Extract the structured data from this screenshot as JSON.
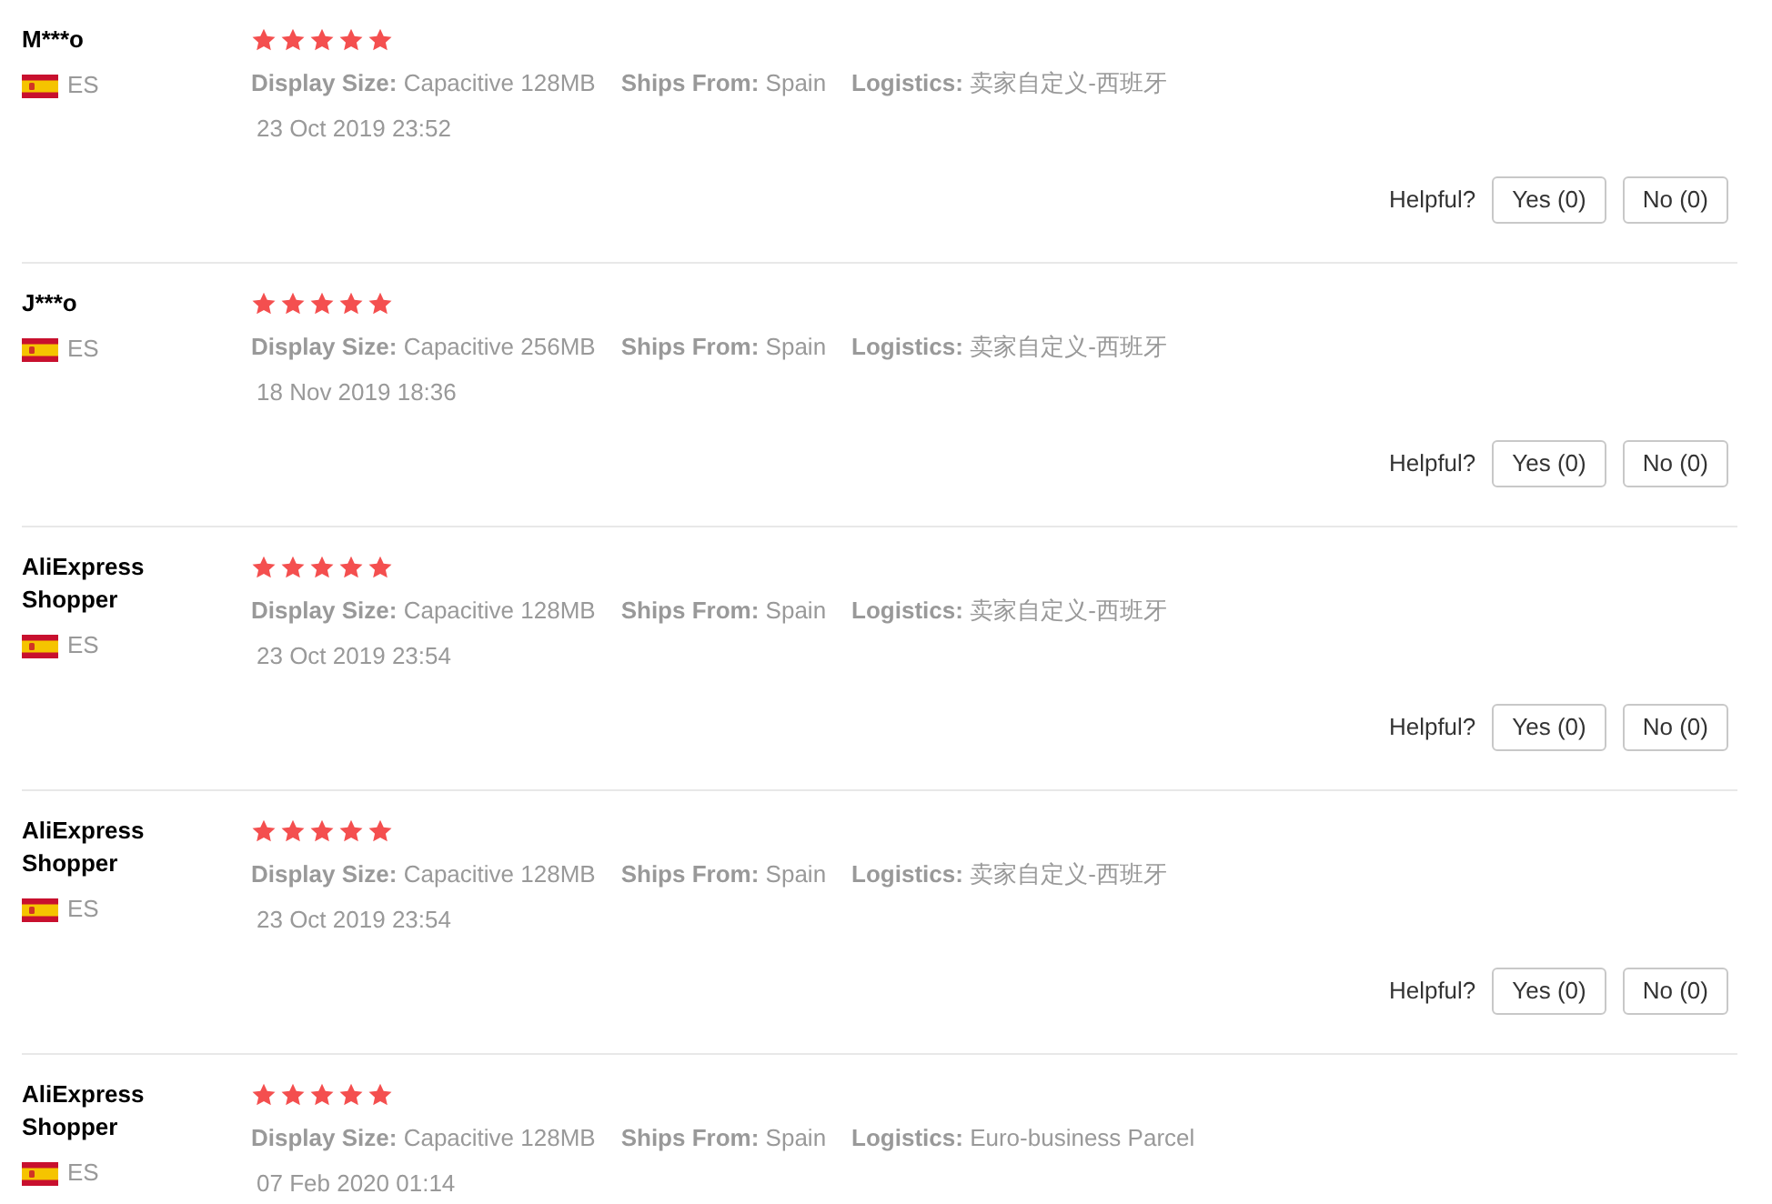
{
  "reviews": [
    {
      "name": "M***o",
      "country": "ES",
      "stars": 5,
      "attributes": [
        {
          "label": "Display Size:",
          "value": "Capacitive 128MB"
        },
        {
          "label": "Ships From:",
          "value": "Spain"
        },
        {
          "label": "Logistics:",
          "value": "卖家自定义-西班牙"
        }
      ],
      "date": "23 Oct 2019 23:52",
      "helpful": {
        "label": "Helpful?",
        "buttons": [
          "Yes (0)",
          "No (0)"
        ]
      }
    },
    {
      "name": "J***o",
      "country": "ES",
      "stars": 5,
      "attributes": [
        {
          "label": "Display Size:",
          "value": "Capacitive 256MB"
        },
        {
          "label": "Ships From:",
          "value": "Spain"
        },
        {
          "label": "Logistics:",
          "value": "卖家自定义-西班牙"
        }
      ],
      "date": "18 Nov 2019 18:36",
      "helpful": {
        "label": "Helpful?",
        "buttons": [
          "Yes (0)",
          "No (0)"
        ]
      }
    },
    {
      "name": "AliExpress Shopper",
      "country": "ES",
      "stars": 5,
      "attributes": [
        {
          "label": "Display Size:",
          "value": "Capacitive 128MB"
        },
        {
          "label": "Ships From:",
          "value": "Spain"
        },
        {
          "label": "Logistics:",
          "value": "卖家自定义-西班牙"
        }
      ],
      "date": "23 Oct 2019 23:54",
      "helpful": {
        "label": "Helpful?",
        "buttons": [
          "Yes (0)",
          "No (0)"
        ]
      }
    },
    {
      "name": "AliExpress Shopper",
      "country": "ES",
      "stars": 5,
      "attributes": [
        {
          "label": "Display Size:",
          "value": "Capacitive 128MB"
        },
        {
          "label": "Ships From:",
          "value": "Spain"
        },
        {
          "label": "Logistics:",
          "value": "卖家自定义-西班牙"
        }
      ],
      "date": "23 Oct 2019 23:54",
      "helpful": {
        "label": "Helpful?",
        "buttons": [
          "Yes (0)",
          "No (0)"
        ]
      }
    },
    {
      "name": "AliExpress Shopper",
      "country": "ES",
      "stars": 5,
      "attributes": [
        {
          "label": "Display Size:",
          "value": "Capacitive 128MB"
        },
        {
          "label": "Ships From:",
          "value": "Spain"
        },
        {
          "label": "Logistics:",
          "value": "Euro-business Parcel"
        }
      ],
      "date": "07 Feb 2020 01:14"
    }
  ]
}
